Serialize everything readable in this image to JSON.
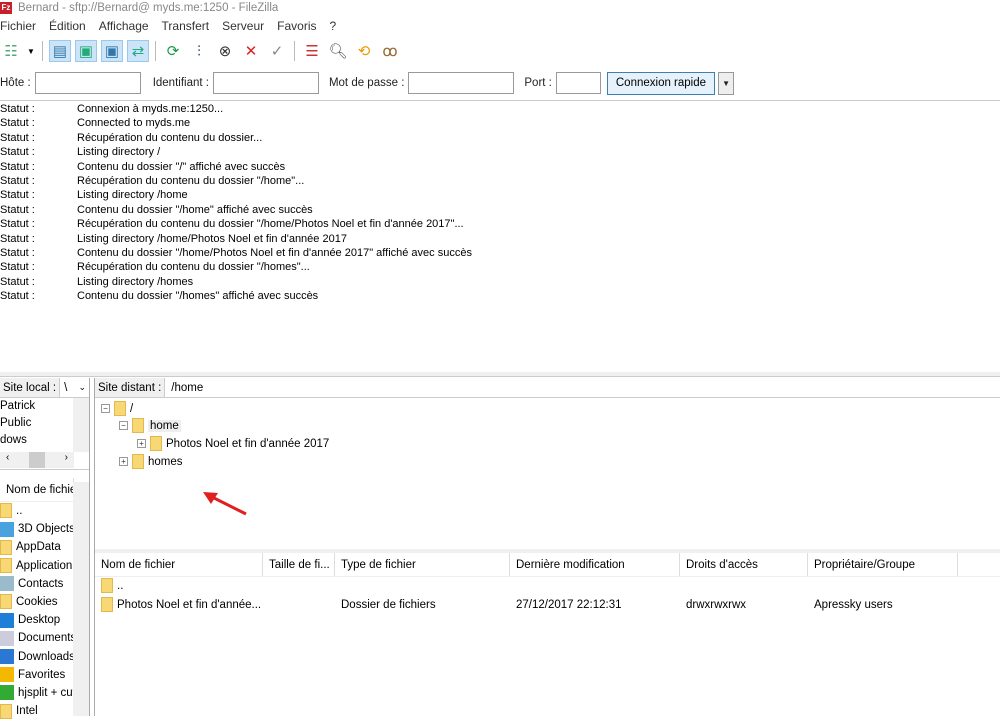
{
  "title": "Bernard - sftp://Bernard@      myds.me:1250 - FileZilla",
  "menu": [
    "Fichier",
    "Édition",
    "Affichage",
    "Transfert",
    "Serveur",
    "Favoris",
    "?"
  ],
  "quickconnect": {
    "host_label": "Hôte :",
    "user_label": "Identifiant :",
    "pass_label": "Mot de passe :",
    "port_label": "Port :",
    "button": "Connexion rapide",
    "host": "",
    "user": "",
    "pass": "",
    "port": ""
  },
  "log": [
    {
      "l": "Statut :",
      "m": "Connexion à       myds.me:1250..."
    },
    {
      "l": "Statut :",
      "m": "Connected to       myds.me"
    },
    {
      "l": "Statut :",
      "m": "Récupération du contenu du dossier..."
    },
    {
      "l": "Statut :",
      "m": "Listing directory /"
    },
    {
      "l": "Statut :",
      "m": "Contenu du dossier \"/\" affiché avec succès"
    },
    {
      "l": "Statut :",
      "m": "Récupération du contenu du dossier \"/home\"..."
    },
    {
      "l": "Statut :",
      "m": "Listing directory /home"
    },
    {
      "l": "Statut :",
      "m": "Contenu du dossier \"/home\" affiché avec succès"
    },
    {
      "l": "Statut :",
      "m": "Récupération du contenu du dossier \"/home/Photos Noel et fin d'année 2017\"..."
    },
    {
      "l": "Statut :",
      "m": "Listing directory /home/Photos Noel et fin d'année 2017"
    },
    {
      "l": "Statut :",
      "m": "Contenu du dossier \"/home/Photos Noel et fin d'année 2017\" affiché avec succès"
    },
    {
      "l": "Statut :",
      "m": "Récupération du contenu du dossier \"/homes\"..."
    },
    {
      "l": "Statut :",
      "m": "Listing directory /homes"
    },
    {
      "l": "Statut :",
      "m": "Contenu du dossier \"/homes\" affiché avec succès"
    }
  ],
  "local": {
    "label": "Site local :",
    "path": "\\",
    "tree": [
      "Patrick",
      "Public",
      "dows"
    ],
    "header": "Nom de fichier",
    "files": [
      "..",
      "3D Objects",
      "AppData",
      "Application",
      "Contacts",
      "Cookies",
      "Desktop",
      "Documents",
      "Downloads",
      "Favorites",
      "hjsplit + cut",
      "Intel"
    ]
  },
  "remote": {
    "label": "Site distant :",
    "path": "/home",
    "tree": {
      "root": "/",
      "home": "home",
      "photos": "Photos Noel et fin d'année 2017",
      "homes": "homes"
    },
    "columns": [
      "Nom de fichier",
      "Taille de fi...",
      "Type de fichier",
      "Dernière modification",
      "Droits d'accès",
      "Propriétaire/Groupe"
    ],
    "rows": [
      [
        "..",
        "",
        "",
        "",
        "",
        ""
      ],
      [
        "Photos Noel et fin d'année...",
        "",
        "Dossier de fichiers",
        "27/12/2017 22:12:31",
        "drwxrwxrwx",
        "Apressky users"
      ]
    ]
  }
}
